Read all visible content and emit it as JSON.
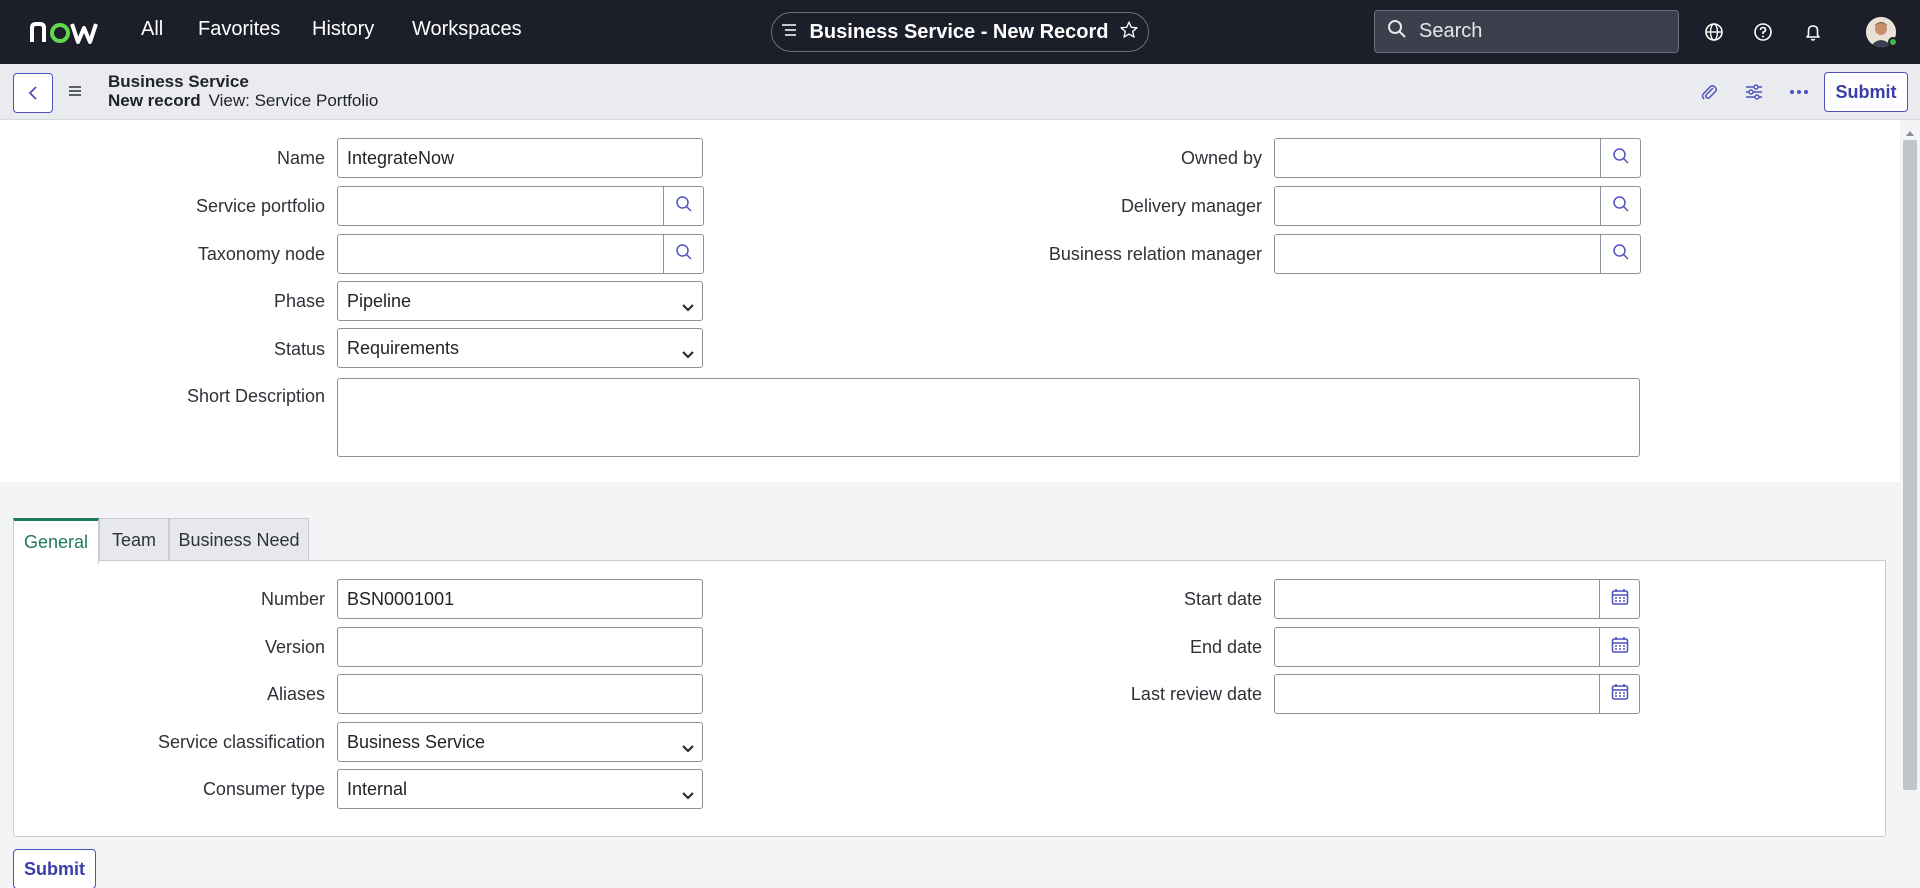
{
  "nav": {
    "logo_text": "now",
    "menu": [
      "All",
      "Favorites",
      "History",
      "Workspaces"
    ],
    "title": "Business Service - New Record",
    "search_placeholder": "Search"
  },
  "header": {
    "table_name": "Business Service",
    "record_label": "New record",
    "view_label": "View: Service Portfolio",
    "submit_label": "Submit"
  },
  "form": {
    "name": {
      "label": "Name",
      "value": "IntegrateNow"
    },
    "service_portfolio": {
      "label": "Service portfolio",
      "value": ""
    },
    "taxonomy_node": {
      "label": "Taxonomy node",
      "value": ""
    },
    "phase": {
      "label": "Phase",
      "value": "Pipeline"
    },
    "status": {
      "label": "Status",
      "value": "Requirements"
    },
    "short_description": {
      "label": "Short Description",
      "value": ""
    },
    "owned_by": {
      "label": "Owned by",
      "value": ""
    },
    "delivery_manager": {
      "label": "Delivery manager",
      "value": ""
    },
    "business_relation_manager": {
      "label": "Business relation manager",
      "value": ""
    }
  },
  "tabs": [
    "General",
    "Team",
    "Business Need"
  ],
  "general": {
    "number": {
      "label": "Number",
      "value": "BSN0001001"
    },
    "version": {
      "label": "Version",
      "value": ""
    },
    "aliases": {
      "label": "Aliases",
      "value": ""
    },
    "service_classification": {
      "label": "Service classification",
      "value": "Business Service"
    },
    "consumer_type": {
      "label": "Consumer type",
      "value": "Internal"
    },
    "start_date": {
      "label": "Start date",
      "value": ""
    },
    "end_date": {
      "label": "End date",
      "value": ""
    },
    "last_review_date": {
      "label": "Last review date",
      "value": ""
    }
  },
  "footer": {
    "submit_label": "Submit"
  },
  "colors": {
    "accent": "#4f52bd",
    "nav_bg": "#1c1f2a",
    "active_tab": "#1e7a5a"
  }
}
